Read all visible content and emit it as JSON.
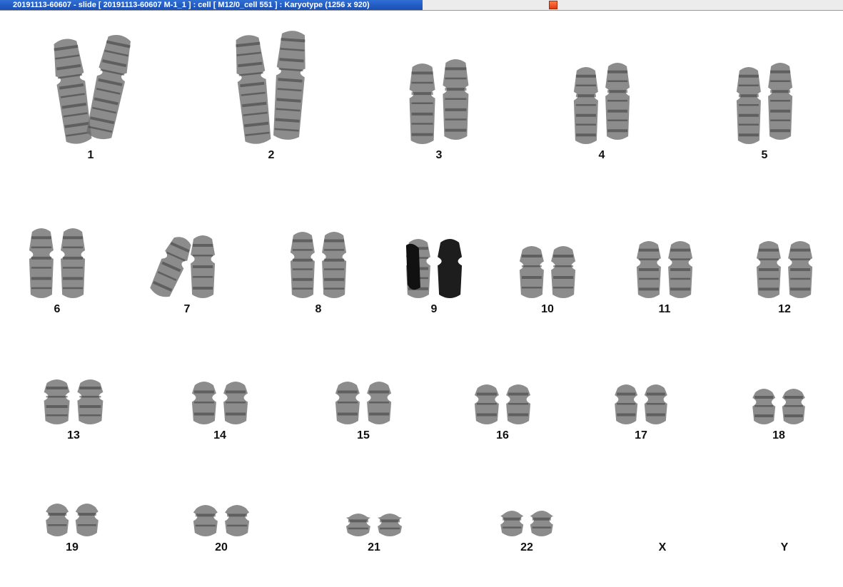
{
  "window": {
    "title": "20191113-60607 - slide [ 20191113-60607 M-1_1 ] : cell [ M12/0_cell 551 ] : Karyotype  (1256 x 920)"
  },
  "karyotype": {
    "chromosomes": [
      {
        "label": "1",
        "present": true,
        "highlight": false
      },
      {
        "label": "2",
        "present": true,
        "highlight": false
      },
      {
        "label": "3",
        "present": true,
        "highlight": false
      },
      {
        "label": "4",
        "present": true,
        "highlight": false
      },
      {
        "label": "5",
        "present": true,
        "highlight": false
      },
      {
        "label": "6",
        "present": true,
        "highlight": false
      },
      {
        "label": "7",
        "present": true,
        "highlight": false
      },
      {
        "label": "8",
        "present": true,
        "highlight": false
      },
      {
        "label": "9",
        "present": true,
        "highlight": true
      },
      {
        "label": "10",
        "present": true,
        "highlight": false
      },
      {
        "label": "11",
        "present": true,
        "highlight": false
      },
      {
        "label": "12",
        "present": true,
        "highlight": false
      },
      {
        "label": "13",
        "present": true,
        "highlight": false
      },
      {
        "label": "14",
        "present": true,
        "highlight": false
      },
      {
        "label": "15",
        "present": true,
        "highlight": false
      },
      {
        "label": "16",
        "present": true,
        "highlight": false
      },
      {
        "label": "17",
        "present": true,
        "highlight": false
      },
      {
        "label": "18",
        "present": true,
        "highlight": false
      },
      {
        "label": "19",
        "present": true,
        "highlight": false
      },
      {
        "label": "20",
        "present": true,
        "highlight": false
      },
      {
        "label": "21",
        "present": true,
        "highlight": false
      },
      {
        "label": "22",
        "present": true,
        "highlight": false
      },
      {
        "label": "X",
        "present": false,
        "highlight": false
      },
      {
        "label": "Y",
        "present": false,
        "highlight": false
      }
    ]
  },
  "colors": {
    "title_bar": "#1b4fb3",
    "chromosome": "#6b6b6b",
    "band": "#3a3a3a",
    "highlight": "#111111"
  }
}
